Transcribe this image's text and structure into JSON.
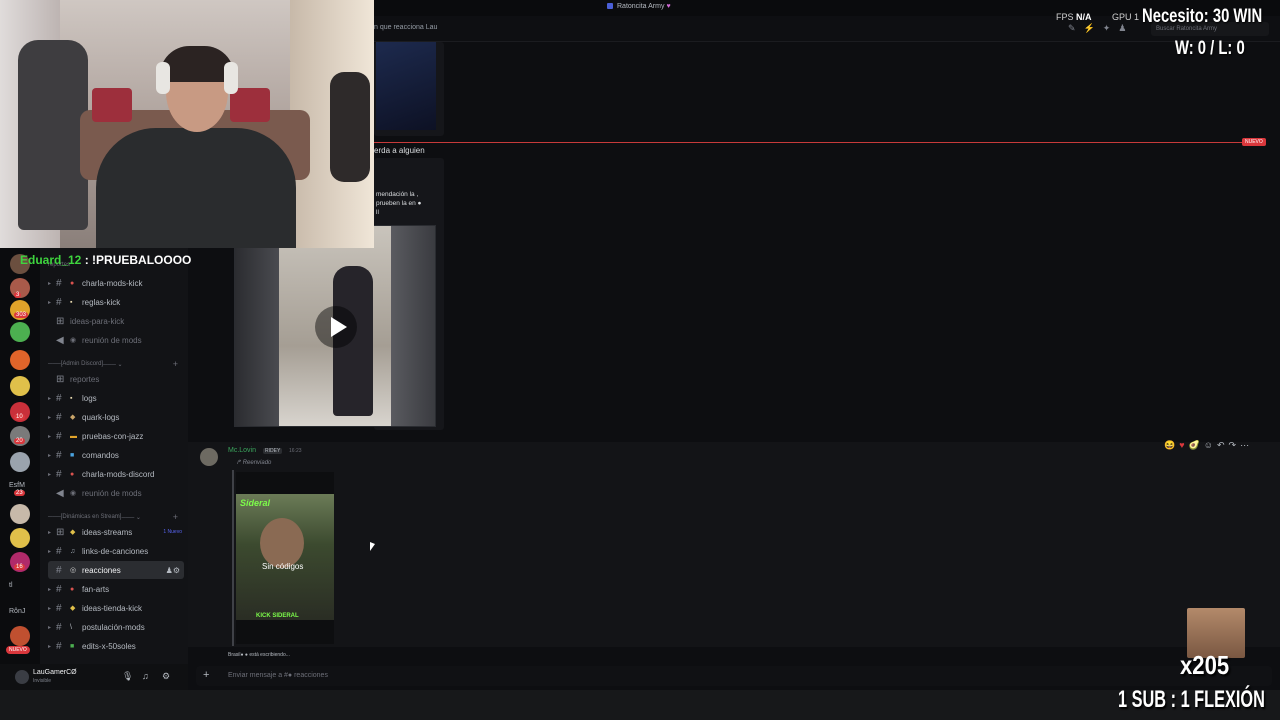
{
  "window": {
    "title": "Ratoncita Army"
  },
  "header": {
    "topic": "n que reacciona Lau",
    "search_placeholder": "Buscar Ratoncita Army"
  },
  "stream_overlay": {
    "chat_username": "Eduard_12",
    "chat_separator": ":",
    "chat_message": "!PRUEBALOOOO",
    "fps_label": "FPS",
    "fps_value": "N/A",
    "gpu_label": "GPU",
    "gpu_value": "1",
    "goal_line1": "Necesito: 30 WIN",
    "goal_line2": "W: 0 / L: 0",
    "sub_multiplier": "x205",
    "sub_rule": "1 SUB : 1 FLEXIÓN"
  },
  "server_rail": {
    "badges": [
      "3",
      "303",
      "10",
      "20",
      "23",
      "16"
    ],
    "labels": [
      "EsfM",
      "tl",
      "RônJ"
    ],
    "nuevo": "NUEVO"
  },
  "sidebar": {
    "partial_top": "reportes",
    "items": [
      {
        "type": "channel",
        "label": "charla-mods-kick",
        "emoji": "●",
        "muted": false
      },
      {
        "type": "channel",
        "label": "reglas-kick",
        "emoji": "▪",
        "muted": false
      },
      {
        "type": "channel",
        "label": "ideas-para-kick",
        "emoji": "",
        "muted": true
      },
      {
        "type": "voice",
        "label": "reunión de mods",
        "emoji": "◉",
        "muted": true
      },
      {
        "type": "category",
        "label": "[Admin Discord]"
      },
      {
        "type": "channel",
        "label": "reportes",
        "emoji": "",
        "muted": true
      },
      {
        "type": "channel",
        "label": "logs",
        "emoji": "▪",
        "muted": false
      },
      {
        "type": "channel",
        "label": "quark-logs",
        "emoji": "◆",
        "muted": false
      },
      {
        "type": "channel",
        "label": "pruebas-con-jazz",
        "emoji": "▬",
        "muted": false
      },
      {
        "type": "channel",
        "label": "comandos",
        "emoji": "■",
        "muted": false
      },
      {
        "type": "channel",
        "label": "charla-mods-discord",
        "emoji": "●",
        "muted": false
      },
      {
        "type": "voice",
        "label": "reunión de mods",
        "emoji": "◉",
        "muted": true
      },
      {
        "type": "category",
        "label": "[Dinámicas en Stream]"
      },
      {
        "type": "channel",
        "label": "ideas-streams",
        "emoji": "◆",
        "muted": false,
        "tag": "1 Nuevo"
      },
      {
        "type": "channel",
        "label": "links-de-canciones",
        "emoji": "♫",
        "muted": false
      },
      {
        "type": "channel",
        "label": "reacciones",
        "emoji": "◎",
        "muted": false,
        "active": true
      },
      {
        "type": "channel",
        "label": "fan-arts",
        "emoji": "●",
        "muted": false
      },
      {
        "type": "channel",
        "label": "ideas-tienda-kick",
        "emoji": "◆",
        "muted": false
      },
      {
        "type": "channel",
        "label": "postulación-mods",
        "emoji": "\\",
        "muted": false
      },
      {
        "type": "channel",
        "label": "edits-x-50soles",
        "emoji": "■",
        "muted": false
      }
    ]
  },
  "user_panel": {
    "name": "LauGamerCØ",
    "status": "Invisible"
  },
  "messages": {
    "new_marker": "NUEVO",
    "reply_snippet": "erda a alguien",
    "quote_text": "mendación la , prueben la en ● ll",
    "author": "Mc.Lovin",
    "author_tag": "RIDEY",
    "time": "16:23",
    "forwarded_label": "Reenviado",
    "thumb_title": "Sideral",
    "thumb_caption": "Sin códigos",
    "thumb_footer": "KICK SIDERAL",
    "typing": "Brasil● ● está escribiendo..."
  },
  "composer": {
    "placeholder": "Enviar mensaje a #● reacciones"
  }
}
